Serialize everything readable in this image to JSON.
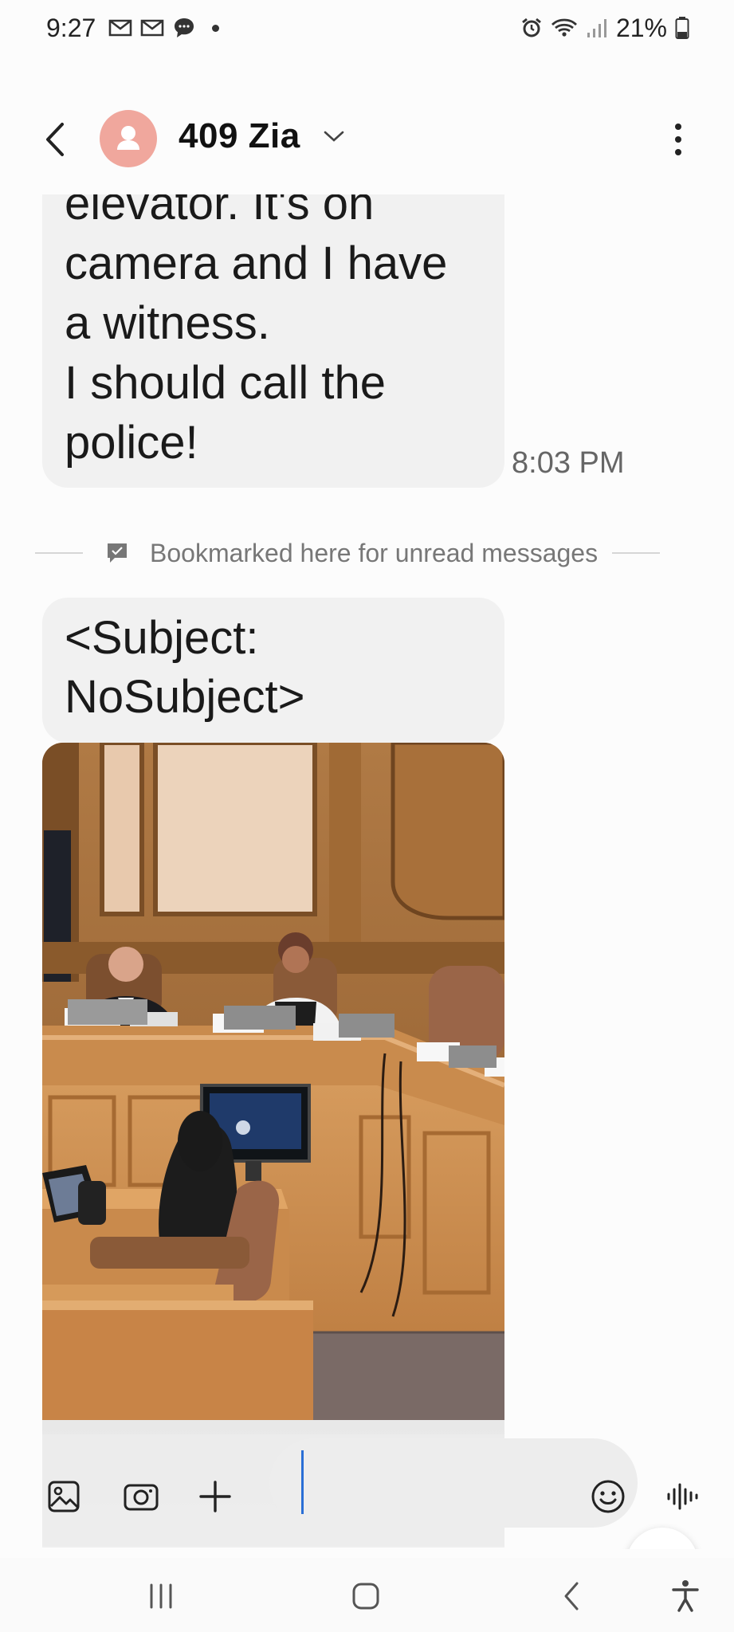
{
  "status_bar": {
    "time": "9:27",
    "battery_percent": "21%",
    "icons": [
      "gmail-icon",
      "gmail-icon",
      "chat-bubble-icon",
      "notification-dot",
      "alarm-icon",
      "wifi-icon",
      "signal-icon",
      "battery-icon"
    ]
  },
  "header": {
    "contact_name": "409 Zia",
    "avatar_color": "#f0a79d"
  },
  "messages": {
    "previous": {
      "lines": [
        "elevator. It's on",
        "camera and I have",
        "a witness.",
        "I should call the",
        "police!"
      ],
      "time": "8:03 PM"
    },
    "bookmark_text": "Bookmarked here for unread messages",
    "subject_message": {
      "lines": [
        "<Subject:",
        "NoSubject>"
      ]
    }
  },
  "composer": {
    "input_value": "",
    "input_placeholder": ""
  },
  "colors": {
    "bubble": "#f1f1f1",
    "background": "#fcfcfc",
    "caret": "#2a6fd6"
  }
}
